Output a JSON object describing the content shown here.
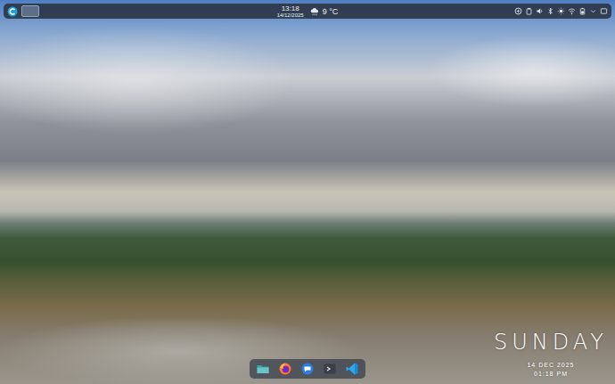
{
  "top_panel": {
    "pager": [
      {
        "selected": true
      }
    ],
    "clock": {
      "time": "13:18",
      "date": "14/12/2025"
    },
    "weather": {
      "temperature": "9 °C"
    }
  },
  "desktop_widget": {
    "day": "SUNDAY",
    "date": "14 DEC 2025",
    "time": "01:18 PM"
  }
}
